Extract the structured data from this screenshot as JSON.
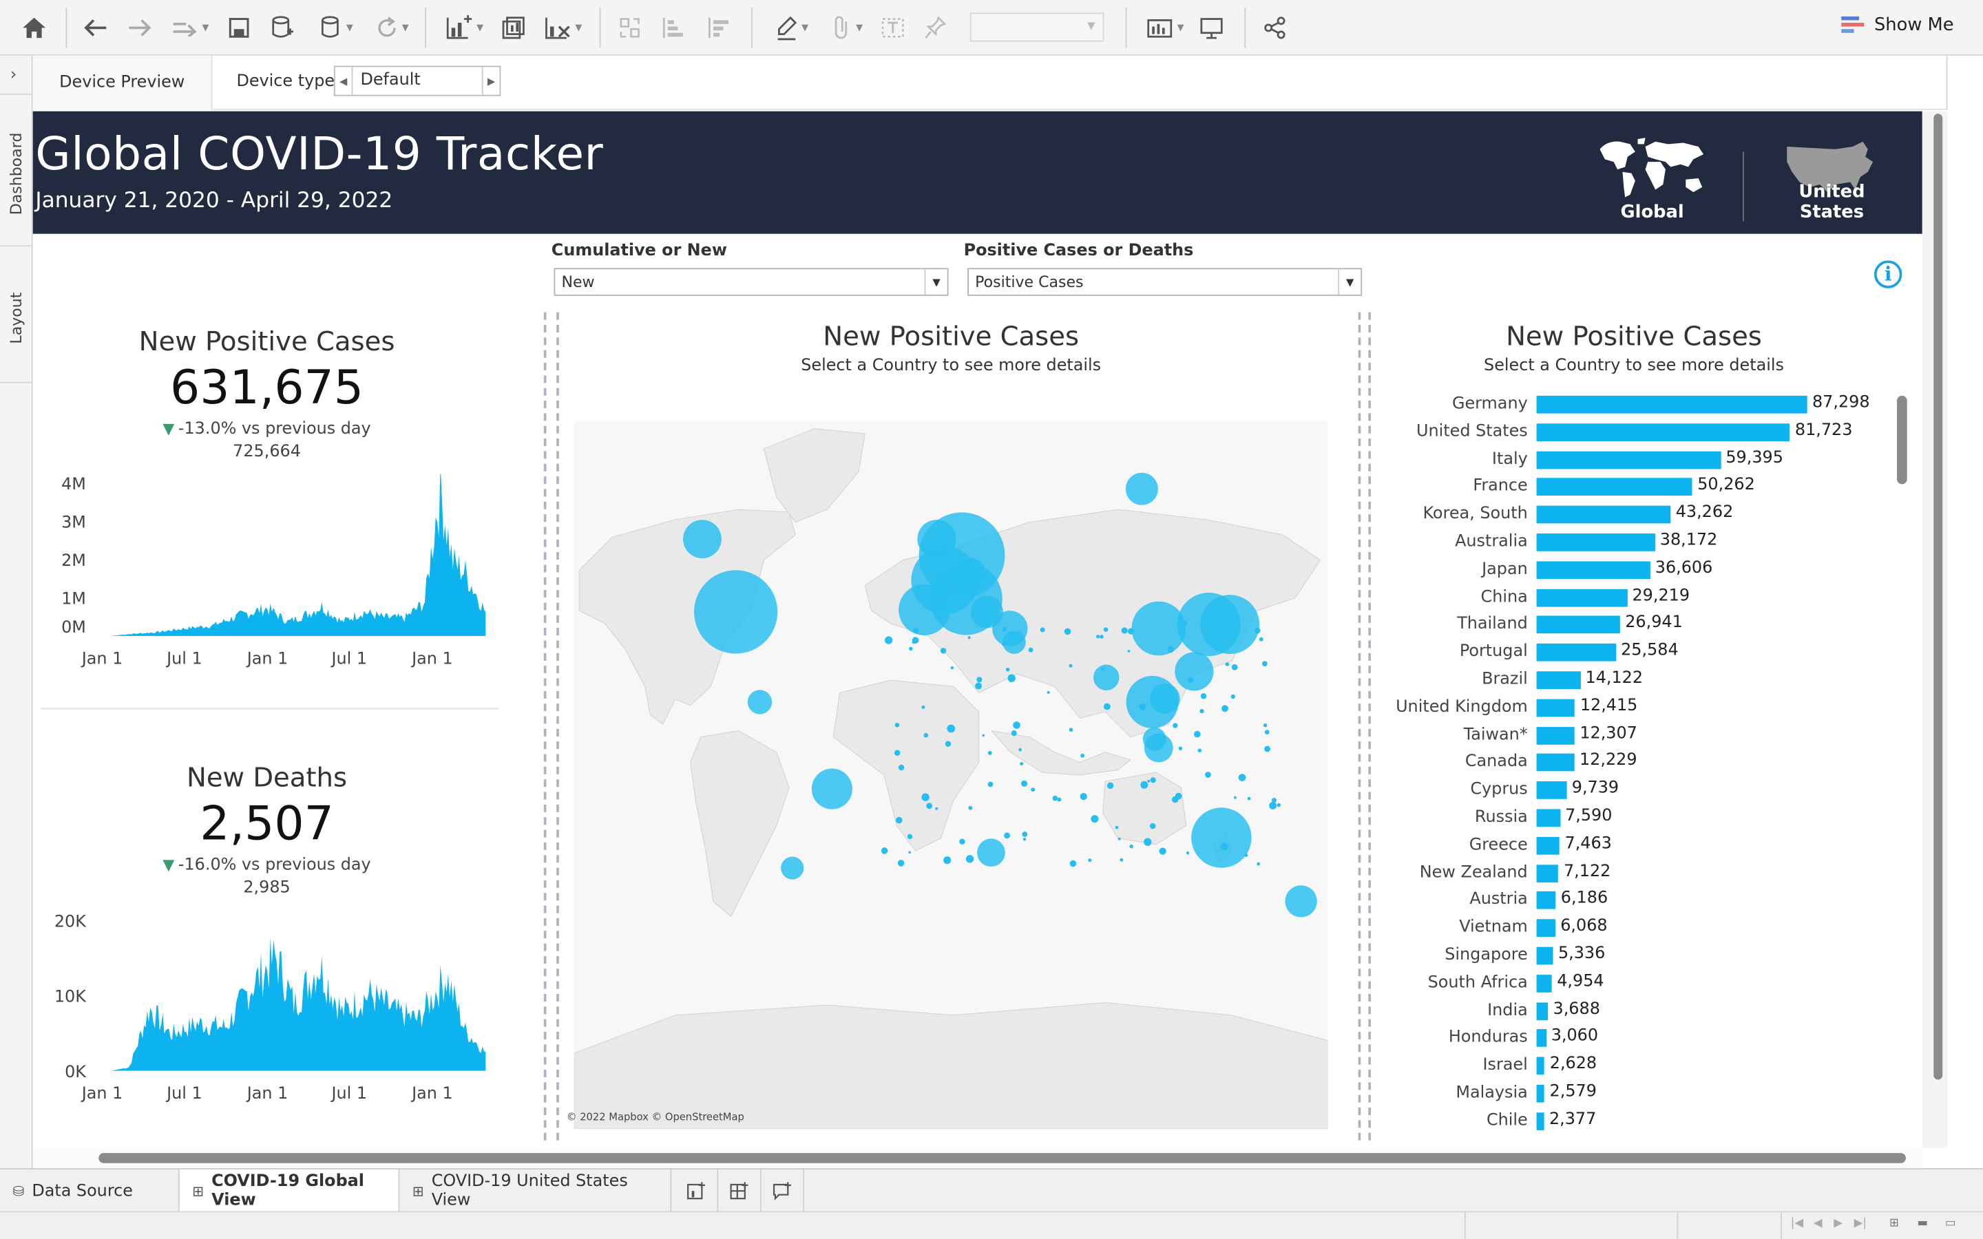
{
  "toolbar": {
    "show_me_label": "Show Me"
  },
  "left_rail": {
    "tabs": [
      "Dashboard",
      "Layout"
    ]
  },
  "device_bar": {
    "preview_label": "Device Preview",
    "type_label": "Device type",
    "type_value": "Default"
  },
  "header": {
    "title": "Global COVID-19 Tracker",
    "subtitle": "January 21, 2020 - April 29, 2022",
    "global_label": "Global",
    "us_label": "United States"
  },
  "filters": {
    "cumulative_label": "Cumulative or New",
    "cumulative_value": "New",
    "measure_label": "Positive Cases or Deaths",
    "measure_value": "Positive Cases",
    "info_icon": "i"
  },
  "kpi_cases": {
    "title": "New Positive Cases",
    "value": "631,675",
    "delta": "-13.0% vs previous day",
    "previous": "725,664",
    "y_ticks": [
      "4M",
      "3M",
      "2M",
      "1M",
      "0M"
    ],
    "x_ticks": [
      "Jan 1",
      "Jul 1",
      "Jan 1",
      "Jul 1",
      "Jan 1"
    ]
  },
  "kpi_deaths": {
    "title": "New Deaths",
    "value": "2,507",
    "delta": "-16.0% vs previous day",
    "previous": "2,985",
    "y_ticks": [
      "20K",
      "10K",
      "0K"
    ],
    "x_ticks": [
      "Jan 1",
      "Jul 1",
      "Jan 1",
      "Jul 1",
      "Jan 1"
    ]
  },
  "map_panel": {
    "title": "New Positive Cases",
    "subtitle": "Select a Country to see more details",
    "credit": "© 2022 Mapbox © OpenStreetMap"
  },
  "bar_panel": {
    "title": "New Positive Cases",
    "subtitle": "Select a Country to see more details"
  },
  "chart_data": [
    {
      "type": "area",
      "title": "New Positive Cases",
      "xlabel": "",
      "ylabel": "",
      "ylim": [
        0,
        4000000
      ],
      "x": [
        "2020-01-21",
        "2020-03-01",
        "2020-05-01",
        "2020-07-01",
        "2020-09-01",
        "2020-11-01",
        "2021-01-01",
        "2021-02-15",
        "2021-04-01",
        "2021-05-01",
        "2021-06-15",
        "2021-08-01",
        "2021-09-15",
        "2021-11-01",
        "2021-12-15",
        "2022-01-10",
        "2022-01-20",
        "2022-02-15",
        "2022-03-15",
        "2022-04-29"
      ],
      "values": [
        0,
        50000,
        100000,
        200000,
        280000,
        550000,
        750000,
        380000,
        600000,
        800000,
        380000,
        650000,
        500000,
        480000,
        900000,
        3300000,
        3800000,
        2000000,
        1700000,
        631675
      ]
    },
    {
      "type": "area",
      "title": "New Deaths",
      "xlabel": "",
      "ylabel": "",
      "ylim": [
        0,
        20000
      ],
      "x": [
        "2020-01-21",
        "2020-03-01",
        "2020-04-15",
        "2020-06-01",
        "2020-08-01",
        "2020-10-01",
        "2020-12-01",
        "2021-01-20",
        "2021-03-01",
        "2021-04-25",
        "2021-06-15",
        "2021-08-15",
        "2021-10-15",
        "2021-12-01",
        "2022-02-01",
        "2022-03-15",
        "2022-04-29"
      ],
      "values": [
        0,
        500,
        8500,
        5000,
        6500,
        6000,
        12000,
        15500,
        9000,
        14500,
        8000,
        10500,
        8000,
        7000,
        13000,
        5500,
        2507
      ]
    },
    {
      "type": "bar",
      "orientation": "horizontal",
      "title": "New Positive Cases",
      "categories": [
        "Germany",
        "United States",
        "Italy",
        "France",
        "Korea, South",
        "Australia",
        "Japan",
        "China",
        "Thailand",
        "Portugal",
        "Brazil",
        "United Kingdom",
        "Taiwan*",
        "Canada",
        "Cyprus",
        "Russia",
        "Greece",
        "New Zealand",
        "Austria",
        "Vietnam",
        "Singapore",
        "South Africa",
        "India",
        "Honduras",
        "Israel",
        "Malaysia",
        "Chile"
      ],
      "values": [
        87298,
        81723,
        59395,
        50262,
        43262,
        38172,
        36606,
        29219,
        26941,
        25584,
        14122,
        12415,
        12307,
        12229,
        9739,
        7590,
        7463,
        7122,
        6186,
        6068,
        5336,
        4954,
        3688,
        3060,
        2628,
        2579,
        2377
      ],
      "labels": [
        "87,298",
        "81,723",
        "59,395",
        "50,262",
        "43,262",
        "38,172",
        "36,606",
        "29,219",
        "26,941",
        "25,584",
        "14,122",
        "12,415",
        "12,307",
        "12,229",
        "9,739",
        "7,590",
        "7,463",
        "7,122",
        "6,186",
        "6,068",
        "5,336",
        "4,954",
        "3,688",
        "3,060",
        "2,628",
        "2,579",
        "2,377"
      ],
      "color": "#0db3ee"
    }
  ],
  "map_bubbles": [
    {
      "country": "United States",
      "lon": -98,
      "lat": 39,
      "value": 81723
    },
    {
      "country": "Canada",
      "lon": -114,
      "lat": 54,
      "value": 12229
    },
    {
      "country": "Germany",
      "lon": 10,
      "lat": 51,
      "value": 87298
    },
    {
      "country": "France",
      "lon": 2,
      "lat": 46,
      "value": 50262
    },
    {
      "country": "Italy",
      "lon": 12,
      "lat": 42,
      "value": 59395
    },
    {
      "country": "United Kingdom",
      "lon": -2,
      "lat": 54,
      "value": 12415
    },
    {
      "country": "Portugal",
      "lon": -8,
      "lat": 39.5,
      "value": 25584
    },
    {
      "country": "Austria",
      "lon": 14,
      "lat": 47.5,
      "value": 6186
    },
    {
      "country": "Greece",
      "lon": 22,
      "lat": 39,
      "value": 7463
    },
    {
      "country": "Cyprus",
      "lon": 33,
      "lat": 35,
      "value": 9739
    },
    {
      "country": "Israel",
      "lon": 35,
      "lat": 31.5,
      "value": 2628
    },
    {
      "country": "Russia",
      "lon": 96,
      "lat": 62,
      "value": 7590
    },
    {
      "country": "China",
      "lon": 104,
      "lat": 35,
      "value": 29219
    },
    {
      "country": "Korea, South",
      "lon": 128,
      "lat": 36,
      "value": 43262
    },
    {
      "country": "Japan",
      "lon": 138,
      "lat": 36,
      "value": 36606
    },
    {
      "country": "Taiwan*",
      "lon": 121,
      "lat": 23.7,
      "value": 12307
    },
    {
      "country": "Vietnam",
      "lon": 107,
      "lat": 16,
      "value": 6068
    },
    {
      "country": "Thailand",
      "lon": 101,
      "lat": 15,
      "value": 26941
    },
    {
      "country": "Malaysia",
      "lon": 102,
      "lat": 4,
      "value": 2579
    },
    {
      "country": "Singapore",
      "lon": 104,
      "lat": 1.3,
      "value": 5336
    },
    {
      "country": "India",
      "lon": 79,
      "lat": 22,
      "value": 3688
    },
    {
      "country": "Australia",
      "lon": 134,
      "lat": -25,
      "value": 38172
    },
    {
      "country": "New Zealand",
      "lon": 172,
      "lat": -41,
      "value": 7122
    },
    {
      "country": "Brazil",
      "lon": -52,
      "lat": -11,
      "value": 14122
    },
    {
      "country": "Honduras",
      "lon": -86.5,
      "lat": 15,
      "value": 3060
    },
    {
      "country": "South Africa",
      "lon": 24,
      "lat": -29,
      "value": 4954
    },
    {
      "country": "Chile",
      "lon": -71,
      "lat": -33,
      "value": 2377
    }
  ],
  "sheet_tabs": {
    "data_source": "Data Source",
    "tab1": "COVID-19 Global View",
    "tab2": "COVID-19 United States View"
  }
}
